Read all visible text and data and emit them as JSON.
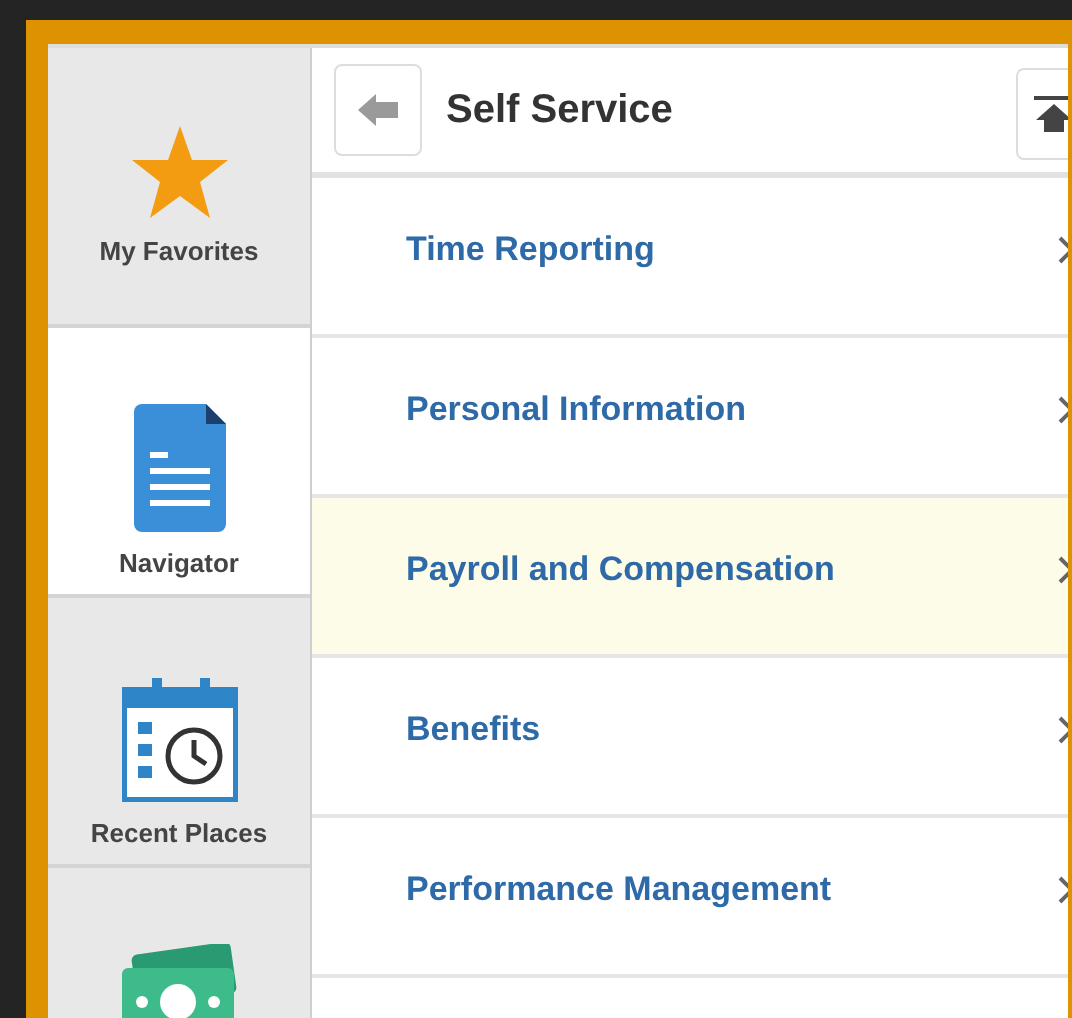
{
  "sidebar": {
    "items": [
      {
        "kind": "star",
        "label": "My Favorites",
        "selected": false
      },
      {
        "kind": "document",
        "label": "Navigator",
        "selected": true
      },
      {
        "kind": "calendar",
        "label": "Recent Places",
        "selected": false
      },
      {
        "kind": "money",
        "selected": false
      }
    ]
  },
  "header": {
    "title": "Self Service"
  },
  "menu": {
    "items": [
      {
        "label": "Time Reporting",
        "selected": false
      },
      {
        "label": "Personal Information",
        "selected": false
      },
      {
        "label": "Payroll and Compensation",
        "selected": true
      },
      {
        "label": "Benefits",
        "selected": false
      },
      {
        "label": "Performance Management",
        "selected": false
      }
    ]
  }
}
